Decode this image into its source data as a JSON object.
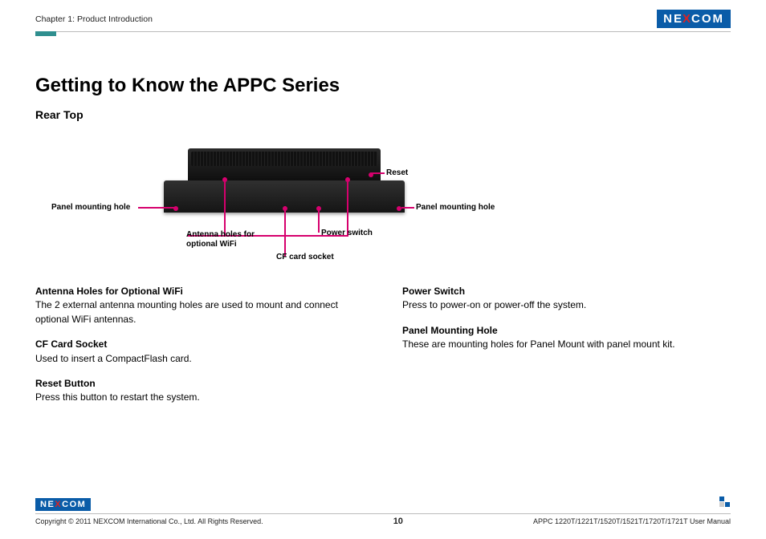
{
  "header": {
    "chapter": "Chapter 1: Product Introduction",
    "logo_text_left": "NE",
    "logo_text_x": "X",
    "logo_text_right": "COM"
  },
  "title": "Getting to Know the APPC Series",
  "subtitle": "Rear Top",
  "diagram_labels": {
    "panel_mounting_hole_left": "Panel mounting hole",
    "antenna_holes_line1": "Antenna holes for",
    "antenna_holes_line2": "optional WiFi",
    "cf_card_socket": "CF card socket",
    "power_switch": "Power switch",
    "reset": "Reset",
    "panel_mounting_hole_right": "Panel mounting hole"
  },
  "left_column": {
    "item1_title": "Antenna Holes for Optional WiFi",
    "item1_body": "The 2 external antenna mounting holes are used to mount and connect optional WiFi antennas.",
    "item2_title": "CF Card Socket",
    "item2_body": "Used to insert a CompactFlash card.",
    "item3_title": "Reset Button",
    "item3_body": "Press this button to restart the system."
  },
  "right_column": {
    "item1_title": "Power Switch",
    "item1_body": "Press to power-on or power-off the system.",
    "item2_title": "Panel Mounting Hole",
    "item2_body": "These are mounting holes for Panel Mount with panel mount kit."
  },
  "footer": {
    "copyright": "Copyright © 2011 NEXCOM International Co., Ltd. All Rights Reserved.",
    "page_number": "10",
    "manual_ref": "APPC 1220T/1221T/1520T/1521T/1720T/1721T User Manual"
  }
}
